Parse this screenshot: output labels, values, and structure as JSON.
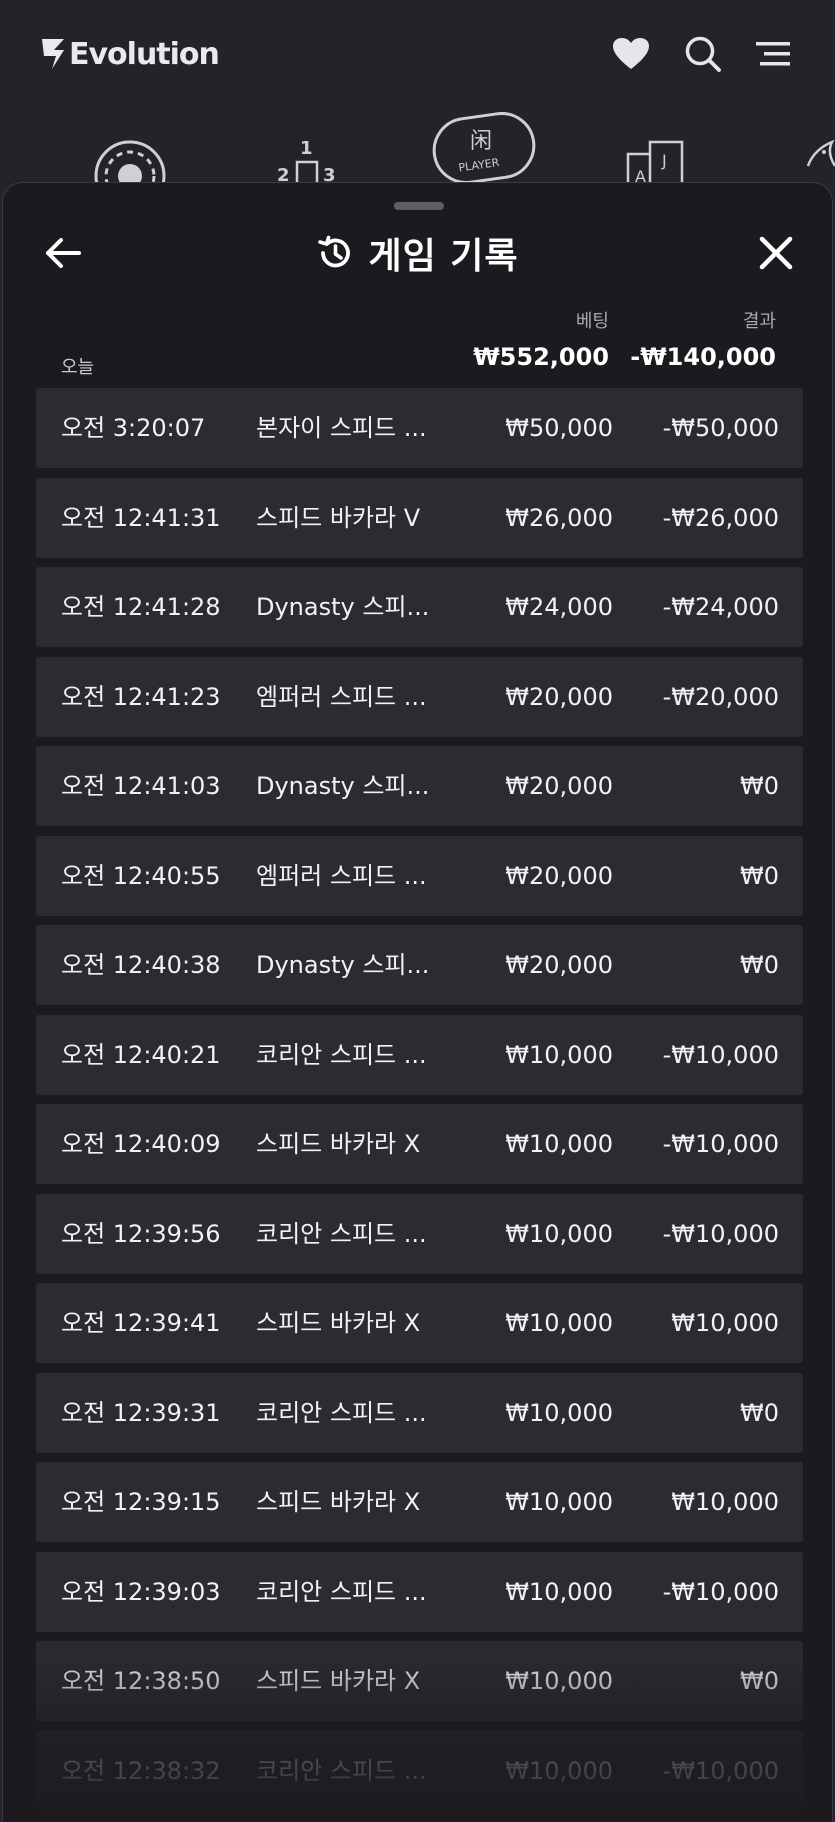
{
  "header": {
    "brand": "Evolution",
    "icons": [
      "heart-icon",
      "search-icon",
      "menu-icon"
    ]
  },
  "categories": [
    "roulette-chip-icon",
    "podium-icon",
    "player-badge-icon",
    "cards-icon",
    "dragon-icon"
  ],
  "category_text": {
    "player_badge_top": "闲",
    "player_badge_word": "PLAYER",
    "podium_1": "1",
    "podium_2": "2",
    "podium_3": "3",
    "card_a": "A",
    "card_j": "J"
  },
  "sheet": {
    "title": "게임 기록",
    "title_icon": "history-icon",
    "back_icon": "arrow-left-icon",
    "close_icon": "close-icon",
    "columns": {
      "bet": "베팅",
      "result": "결과"
    },
    "day_label": "오늘",
    "summary": {
      "bet": "₩552,000",
      "result": "-₩140,000"
    },
    "rows": [
      {
        "time": "오전 3:20:07",
        "game": "본자이 스피드 ...",
        "bet": "₩50,000",
        "result": "-₩50,000"
      },
      {
        "time": "오전 12:41:31",
        "game": "스피드 바카라 V",
        "bet": "₩26,000",
        "result": "-₩26,000"
      },
      {
        "time": "오전 12:41:28",
        "game": "Dynasty 스피...",
        "bet": "₩24,000",
        "result": "-₩24,000"
      },
      {
        "time": "오전 12:41:23",
        "game": "엠퍼러 스피드 ...",
        "bet": "₩20,000",
        "result": "-₩20,000"
      },
      {
        "time": "오전 12:41:03",
        "game": "Dynasty 스피...",
        "bet": "₩20,000",
        "result": "₩0"
      },
      {
        "time": "오전 12:40:55",
        "game": "엠퍼러 스피드 ...",
        "bet": "₩20,000",
        "result": "₩0"
      },
      {
        "time": "오전 12:40:38",
        "game": "Dynasty 스피...",
        "bet": "₩20,000",
        "result": "₩0"
      },
      {
        "time": "오전 12:40:21",
        "game": "코리안 스피드 ...",
        "bet": "₩10,000",
        "result": "-₩10,000"
      },
      {
        "time": "오전 12:40:09",
        "game": "스피드 바카라 X",
        "bet": "₩10,000",
        "result": "-₩10,000"
      },
      {
        "time": "오전 12:39:56",
        "game": "코리안 스피드 ...",
        "bet": "₩10,000",
        "result": "-₩10,000"
      },
      {
        "time": "오전 12:39:41",
        "game": "스피드 바카라 X",
        "bet": "₩10,000",
        "result": "₩10,000"
      },
      {
        "time": "오전 12:39:31",
        "game": "코리안 스피드 ...",
        "bet": "₩10,000",
        "result": "₩0"
      },
      {
        "time": "오전 12:39:15",
        "game": "스피드 바카라 X",
        "bet": "₩10,000",
        "result": "₩10,000"
      },
      {
        "time": "오전 12:39:03",
        "game": "코리안 스피드 ...",
        "bet": "₩10,000",
        "result": "-₩10,000"
      },
      {
        "time": "오전 12:38:50",
        "game": "스피드 바카라 X",
        "bet": "₩10,000",
        "result": "₩0"
      },
      {
        "time": "오전 12:38:32",
        "game": "코리안 스피드 ...",
        "bet": "₩10,000",
        "result": "-₩10,000"
      }
    ]
  },
  "colors": {
    "page_bg": "#232329",
    "sheet_bg": "#1b1b1f",
    "row_bg": "#2b2b30",
    "text": "#ffffff",
    "muted": "#a7a7b0"
  }
}
